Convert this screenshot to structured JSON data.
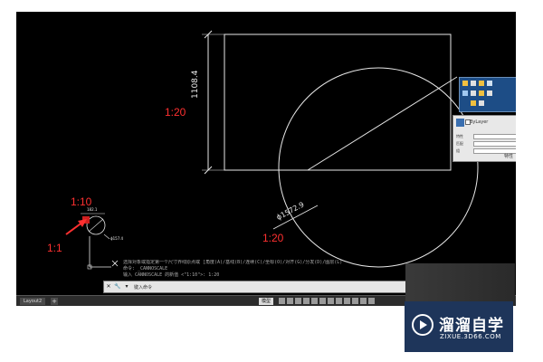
{
  "drawing": {
    "scale_labels": {
      "rect": "1:20",
      "circle": "1:20",
      "detail_top": "1:10",
      "detail_bottom": "1:1"
    },
    "dimension_vertical": "1108.4",
    "dimension_diameter": "ϕ1572.9",
    "detail_dim_small": "182.1",
    "detail_dim_diameter": "ϕ157.4"
  },
  "command": {
    "history": [
      "选择对象或指定第一个尺寸界线原点或 [角度(A)/基线(B)/连续(C)/坐标(O)/对齐(G)/分发(D)/图层(L)",
      "命令: _CANNOSCALE",
      "输入 CANNOSCALE 的新值 <\"1:10\">: 1:20"
    ],
    "placeholder": "键入命令",
    "close_icon": "close-icon",
    "wrench_icon": "wrench-icon"
  },
  "status": {
    "layout_tab": "Layout2",
    "model_label": "模型",
    "add_tab": "+"
  },
  "props_panel": {
    "bylayer": "ByLayer",
    "label_feature": "特性",
    "label_match": "匹配",
    "label_group": "组",
    "footer": "特性"
  },
  "watermark": {
    "title": "溜溜自学",
    "url": "ZIXUE.3D66.COM"
  },
  "colors": {
    "canvas": "#000000",
    "annotation": "#ff3030",
    "geometry": "#e8e8e8",
    "watermark_bg": "#1e355a"
  }
}
